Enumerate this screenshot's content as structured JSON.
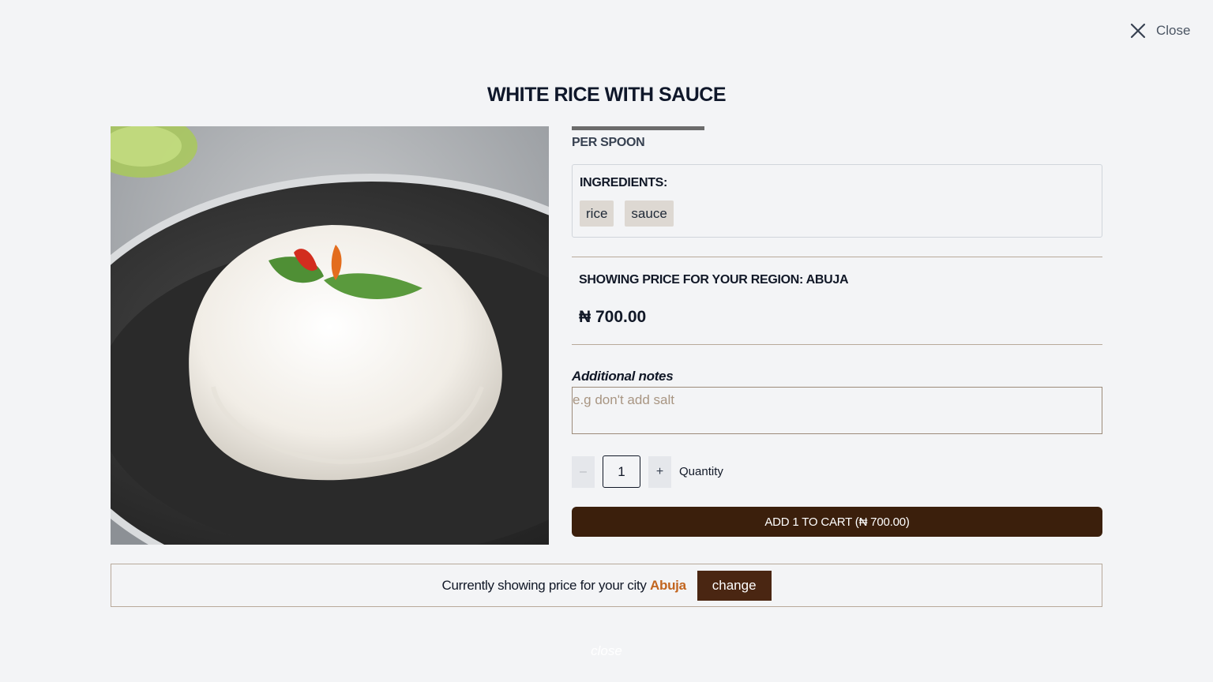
{
  "header": {
    "close_label": "Close"
  },
  "product": {
    "name": "WHITE RICE WITH SAUCE",
    "unit": "PER SPOON",
    "ingredients_title": "INGREDIENTS:",
    "ingredients": [
      "rice",
      "sauce"
    ]
  },
  "pricing": {
    "region_line": "SHOWING PRICE FOR YOUR REGION: ABUJA",
    "price": "₦ 700.00"
  },
  "notes": {
    "label": "Additional notes",
    "placeholder": "e.g don't add salt",
    "value": ""
  },
  "quantity": {
    "minus": "–",
    "value": "1",
    "plus": "+",
    "label": "Quantity"
  },
  "cart": {
    "add_label": "ADD 1 TO CART (₦ 700.00)"
  },
  "city_bar": {
    "text": "Currently showing price for your city",
    "city": "Abuja",
    "change_label": "change"
  },
  "footer": {
    "close_label": "close"
  },
  "colors": {
    "background": "#f3f4f6",
    "primary_button": "#3b1f0c",
    "change_button": "#4a2612",
    "city_accent": "#c2651f"
  }
}
